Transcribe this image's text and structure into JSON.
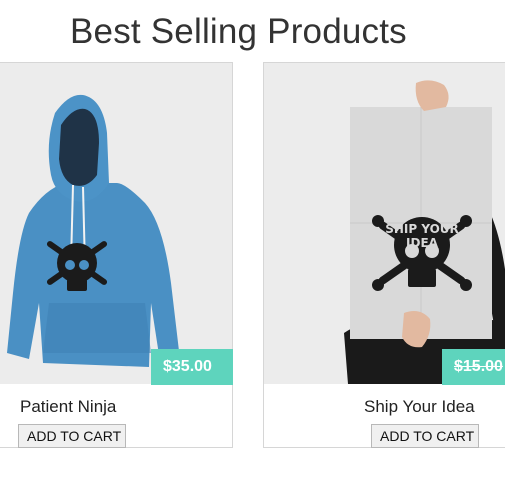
{
  "section": {
    "title": "Best Selling Products"
  },
  "products": [
    {
      "name": "Patient Ninja",
      "price": "$35.00",
      "on_sale": false,
      "button_label": "ADD TO CART",
      "image": "blue-hoodie-skull-print"
    },
    {
      "name": "Ship Your Idea",
      "price": "$15.00",
      "on_sale": true,
      "button_label": "ADD TO CART",
      "image": "poster-ship-your-idea",
      "poster_text": [
        "SHIP YOUR",
        "IDEA"
      ]
    }
  ],
  "colors": {
    "price_badge": "#5ed4bd",
    "hoodie": "#4a90c4",
    "card_border": "#d6d6d6"
  }
}
